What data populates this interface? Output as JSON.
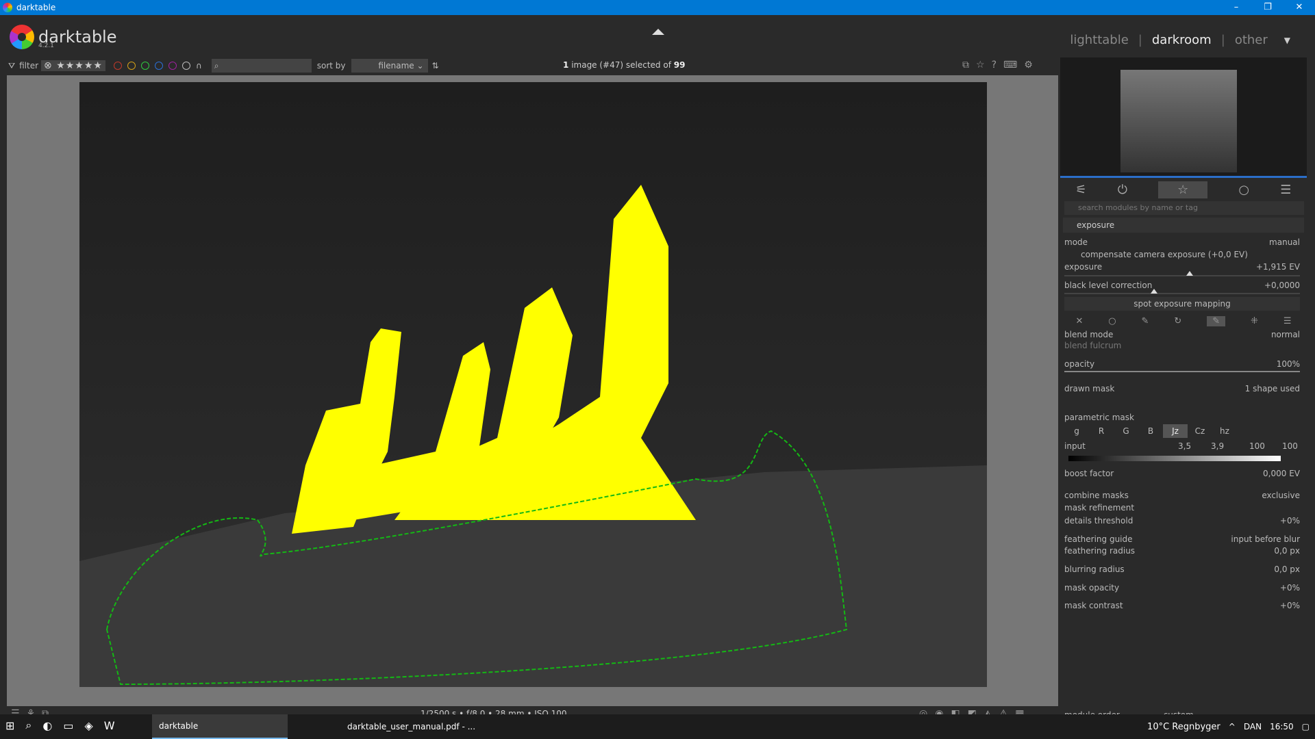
{
  "window": {
    "title": "darktable",
    "min": "–",
    "restore": "❐",
    "close": "✕"
  },
  "brand": {
    "name": "darktable",
    "version": "4.2.1"
  },
  "views": {
    "lighttable": "lighttable",
    "darkroom": "darkroom",
    "other": "other",
    "sep": "|"
  },
  "filterbar": {
    "filter_label": "filter",
    "stars": "⊗ ★★★★★",
    "sort_label": "sort by",
    "sort_value": "filename",
    "colors": [
      "#c0392b",
      "#d4a017",
      "#2ecc40",
      "#2a6fd6",
      "#a020a0",
      "#bbbbbb"
    ]
  },
  "status": {
    "count": "1",
    "text": "image (#47) selected of",
    "total": "99"
  },
  "exif": "1/2500 s • f/8,0 • 28 mm • ISO 100",
  "panel": {
    "search_placeholder": "search modules by name or tag",
    "module_name": "exposure",
    "mode_label": "mode",
    "mode_value": "manual",
    "compensate_label": "compensate camera exposure (+0,0 EV)",
    "exposure_label": "exposure",
    "exposure_value": "+1,915 EV",
    "black_label": "black level correction",
    "black_value": "+0,0000",
    "spot_button": "spot exposure mapping",
    "blend_mode_label": "blend mode",
    "blend_mode_value": "normal",
    "blend_fulcrum_label": "blend fulcrum",
    "opacity_label": "opacity",
    "opacity_value": "100%",
    "drawn_mask_label": "drawn mask",
    "drawn_mask_value": "1 shape used",
    "parametric_label": "parametric mask",
    "channels": [
      "g",
      "R",
      "G",
      "B",
      "Jz",
      "Cz",
      "hz"
    ],
    "input_label": "input",
    "input_values": [
      "3,5",
      "3,9",
      "100",
      "100"
    ],
    "boost_label": "boost factor",
    "boost_value": "0,000 EV",
    "combine_label": "combine masks",
    "combine_value": "exclusive",
    "refinement_label": "mask refinement",
    "details_label": "details threshold",
    "details_value": "+0%",
    "guide_label": "feathering guide",
    "guide_value": "input before blur",
    "feather_radius_label": "feathering radius",
    "feather_radius_value": "0,0 px",
    "blur_label": "blurring radius",
    "blur_value": "0,0 px",
    "mask_opacity_label": "mask opacity",
    "mask_opacity_value": "+0%",
    "mask_contrast_label": "mask contrast",
    "mask_contrast_value": "+0%",
    "module_order_label": "module order",
    "module_order_value": "custom"
  },
  "taskbar": {
    "apps": [
      "darktable",
      "darktable_user_manual.pdf - ..."
    ],
    "weather": "10°C  Regnbyger",
    "lang": "DAN",
    "time": "16:50"
  }
}
